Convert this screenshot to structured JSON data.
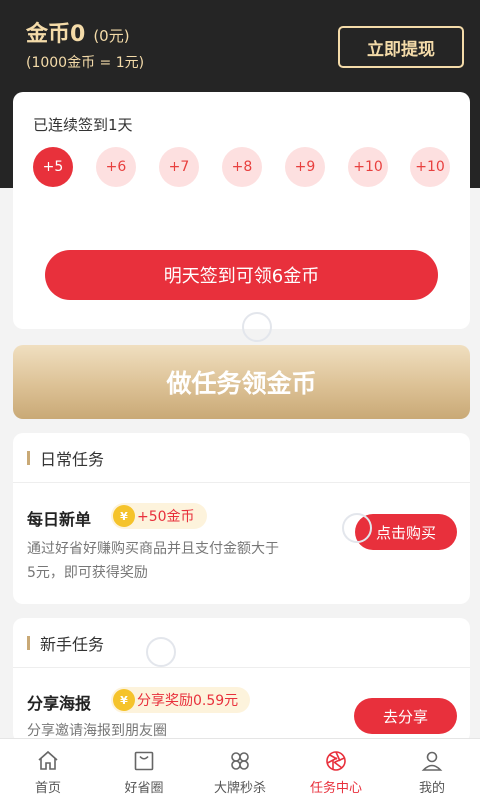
{
  "header": {
    "coins_label": "金币0",
    "yuan_label": "(0元)",
    "rate_label": "(1000金币 = 1元)",
    "withdraw_label": "立即提现"
  },
  "checkin": {
    "status": "已连续签到1天",
    "days": [
      "+5",
      "+6",
      "+7",
      "+8",
      "+9",
      "+10",
      "+10"
    ],
    "tomorrow_button": "明天签到可领6金币"
  },
  "banner": {
    "title": "做任务领金币"
  },
  "daily": {
    "section_title": "日常任务",
    "task": {
      "title": "每日新单",
      "coin_glyph": "¥",
      "reward": "+50金币",
      "desc_line1": "通过好省好赚购买商品并且支付金额大于",
      "desc_line2": "5元，即可获得奖励",
      "button": "点击购买"
    }
  },
  "newbie": {
    "section_title": "新手任务",
    "task": {
      "title": "分享海报",
      "coin_glyph": "¥",
      "reward": "分享奖励0.59元",
      "desc": "分享邀请海报到朋友圈",
      "button": "去分享"
    }
  },
  "tabs": [
    {
      "label": "首页",
      "icon": "home-icon"
    },
    {
      "label": "好省圈",
      "icon": "bag-icon"
    },
    {
      "label": "大牌秒杀",
      "icon": "clover-icon"
    },
    {
      "label": "任务中心",
      "icon": "aperture-icon",
      "active": true
    },
    {
      "label": "我的",
      "icon": "user-icon"
    }
  ],
  "colors": {
    "accent": "#e8303c",
    "gold": "#f4dba9",
    "dark": "#252525"
  }
}
